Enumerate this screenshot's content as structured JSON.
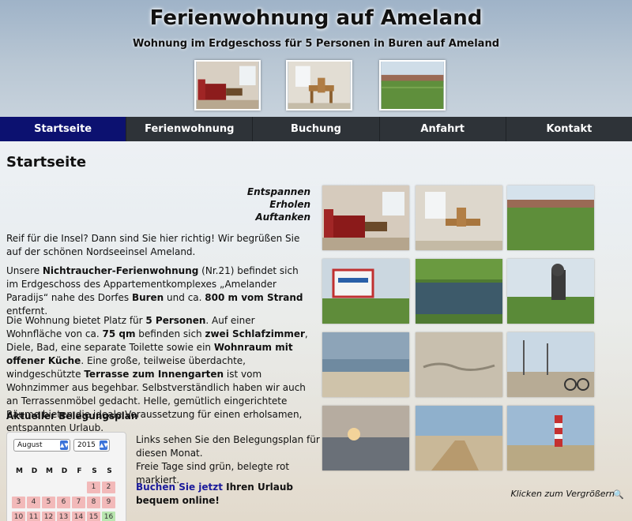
{
  "header": {
    "title": "Ferienwohnung auf Ameland",
    "subtitle": "Wohnung im Erdgeschoss für 5 Personen in Buren auf Ameland"
  },
  "nav": {
    "items": [
      {
        "label": "Startseite",
        "active": true
      },
      {
        "label": "Ferienwohnung",
        "active": false
      },
      {
        "label": "Buchung",
        "active": false
      },
      {
        "label": "Anfahrt",
        "active": false
      },
      {
        "label": "Kontakt",
        "active": false
      }
    ]
  },
  "main": {
    "page_title": "Startseite",
    "tagline": [
      "Entspannen",
      "Erholen",
      "Auftanken"
    ],
    "p1": "Reif für die Insel? Dann sind Sie hier richtig! Wir begrüßen Sie auf der schönen Nordseeinsel Ameland.",
    "p2": {
      "a": "Unsere ",
      "b": "Nichtraucher-Ferienwohnung",
      "c": " (Nr.21) befindet sich im Erdgeschoss des Appartementkomplexes „Amelander Paradijs“ nahe des Dorfes ",
      "d": "Buren",
      "e": " und ca. ",
      "f": "800 m vom Strand",
      "g": " entfernt."
    },
    "p3": {
      "a": "Die Wohnung bietet Platz für ",
      "b": "5 Personen",
      "c": ". Auf einer Wohnfläche von ca. ",
      "d": "75 qm",
      "e": " befinden sich ",
      "f": "zwei Schlafzimmer",
      "g": ", Diele, Bad, eine separate Toilette sowie ein ",
      "h": "Wohnraum mit offener Küche",
      "i": ". Eine große, teilweise überdachte, windgeschützte ",
      "j": "Terrasse zum Innengarten",
      "k": " ist vom Wohnzimmer aus begehbar. Selbstverständlich haben wir auch an Terrassenmöbel gedacht. Helle, gemütlich eingerichtete Räume bieten die ideale Voraussetzung für einen erholsamen, entspannten Urlaub."
    },
    "plan_heading": "Aktueller Belegungsplan",
    "legend_line1": "Links sehen Sie den Belegungsplan für diesen Monat.",
    "legend_line2": "Freie Tage sind grün, belegte rot markiert.",
    "book_link": "Buchen Sie jetzt",
    "book_rest": " Ihren Urlaub bequem online!",
    "zoom_hint": "Klicken zum Vergrößern"
  },
  "calendar": {
    "month": "August",
    "year": "2015",
    "weekdays": [
      "M",
      "D",
      "M",
      "D",
      "F",
      "S",
      "S"
    ],
    "rows": [
      [
        {
          "d": "",
          "s": "empty"
        },
        {
          "d": "",
          "s": "empty"
        },
        {
          "d": "",
          "s": "empty"
        },
        {
          "d": "",
          "s": "empty"
        },
        {
          "d": "",
          "s": "empty"
        },
        {
          "d": "1",
          "s": "busy"
        },
        {
          "d": "2",
          "s": "busy"
        }
      ],
      [
        {
          "d": "3",
          "s": "busy"
        },
        {
          "d": "4",
          "s": "busy"
        },
        {
          "d": "5",
          "s": "busy"
        },
        {
          "d": "6",
          "s": "busy"
        },
        {
          "d": "7",
          "s": "busy"
        },
        {
          "d": "8",
          "s": "busy"
        },
        {
          "d": "9",
          "s": "busy"
        }
      ],
      [
        {
          "d": "10",
          "s": "busy"
        },
        {
          "d": "11",
          "s": "busy"
        },
        {
          "d": "12",
          "s": "busy"
        },
        {
          "d": "13",
          "s": "busy"
        },
        {
          "d": "14",
          "s": "busy"
        },
        {
          "d": "15",
          "s": "busy"
        },
        {
          "d": "16",
          "s": "free"
        }
      ]
    ]
  },
  "colors": {
    "nav_bg": "#2e3338",
    "nav_active": "#0c1170",
    "busy": "#f2b9b9",
    "free": "#b9e6b0",
    "link": "#1a1a9a"
  },
  "icons": {
    "zoom": "magnifier-icon"
  }
}
